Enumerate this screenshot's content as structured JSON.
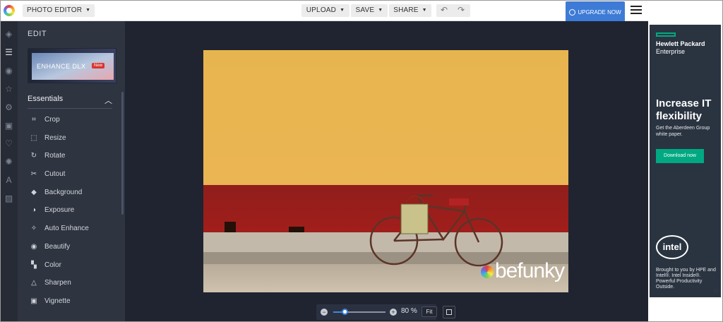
{
  "topbar": {
    "app_menu": "PHOTO EDITOR",
    "upload": "UPLOAD",
    "save": "SAVE",
    "share": "SHARE",
    "upgrade": "UPGRADE NOW"
  },
  "panel": {
    "title": "EDIT",
    "banner_text": "ENHANCE DLX",
    "banner_badge": "New",
    "section": "Essentials",
    "items": [
      {
        "label": "Crop",
        "icon": "crop-icon"
      },
      {
        "label": "Resize",
        "icon": "resize-icon"
      },
      {
        "label": "Rotate",
        "icon": "rotate-icon"
      },
      {
        "label": "Cutout",
        "icon": "cutout-icon"
      },
      {
        "label": "Background",
        "icon": "background-icon"
      },
      {
        "label": "Exposure",
        "icon": "exposure-icon"
      },
      {
        "label": "Auto Enhance",
        "icon": "auto-enhance-icon"
      },
      {
        "label": "Beautify",
        "icon": "beautify-icon"
      },
      {
        "label": "Color",
        "icon": "color-icon"
      },
      {
        "label": "Sharpen",
        "icon": "sharpen-icon"
      },
      {
        "label": "Vignette",
        "icon": "vignette-icon"
      }
    ]
  },
  "canvas": {
    "watermark": "befunky"
  },
  "zoom": {
    "value": "80 %",
    "fit": "Fit"
  },
  "ad": {
    "brand": "Hewlett Packard",
    "brand2": "Enterprise",
    "headline": "Increase IT flexibility",
    "sub": "Get the Aberdeen Group white paper.",
    "cta": "Download now",
    "intel": "intel",
    "footer": "Brought to you by HPE and Intel®. Intel Inside®. Powerful Productivity Outside."
  },
  "colors": {
    "accent": "#3d7bd6",
    "rail": "#262b35",
    "panel": "#2e3440",
    "canvas": "#1f2430",
    "ad_green": "#01a982"
  }
}
